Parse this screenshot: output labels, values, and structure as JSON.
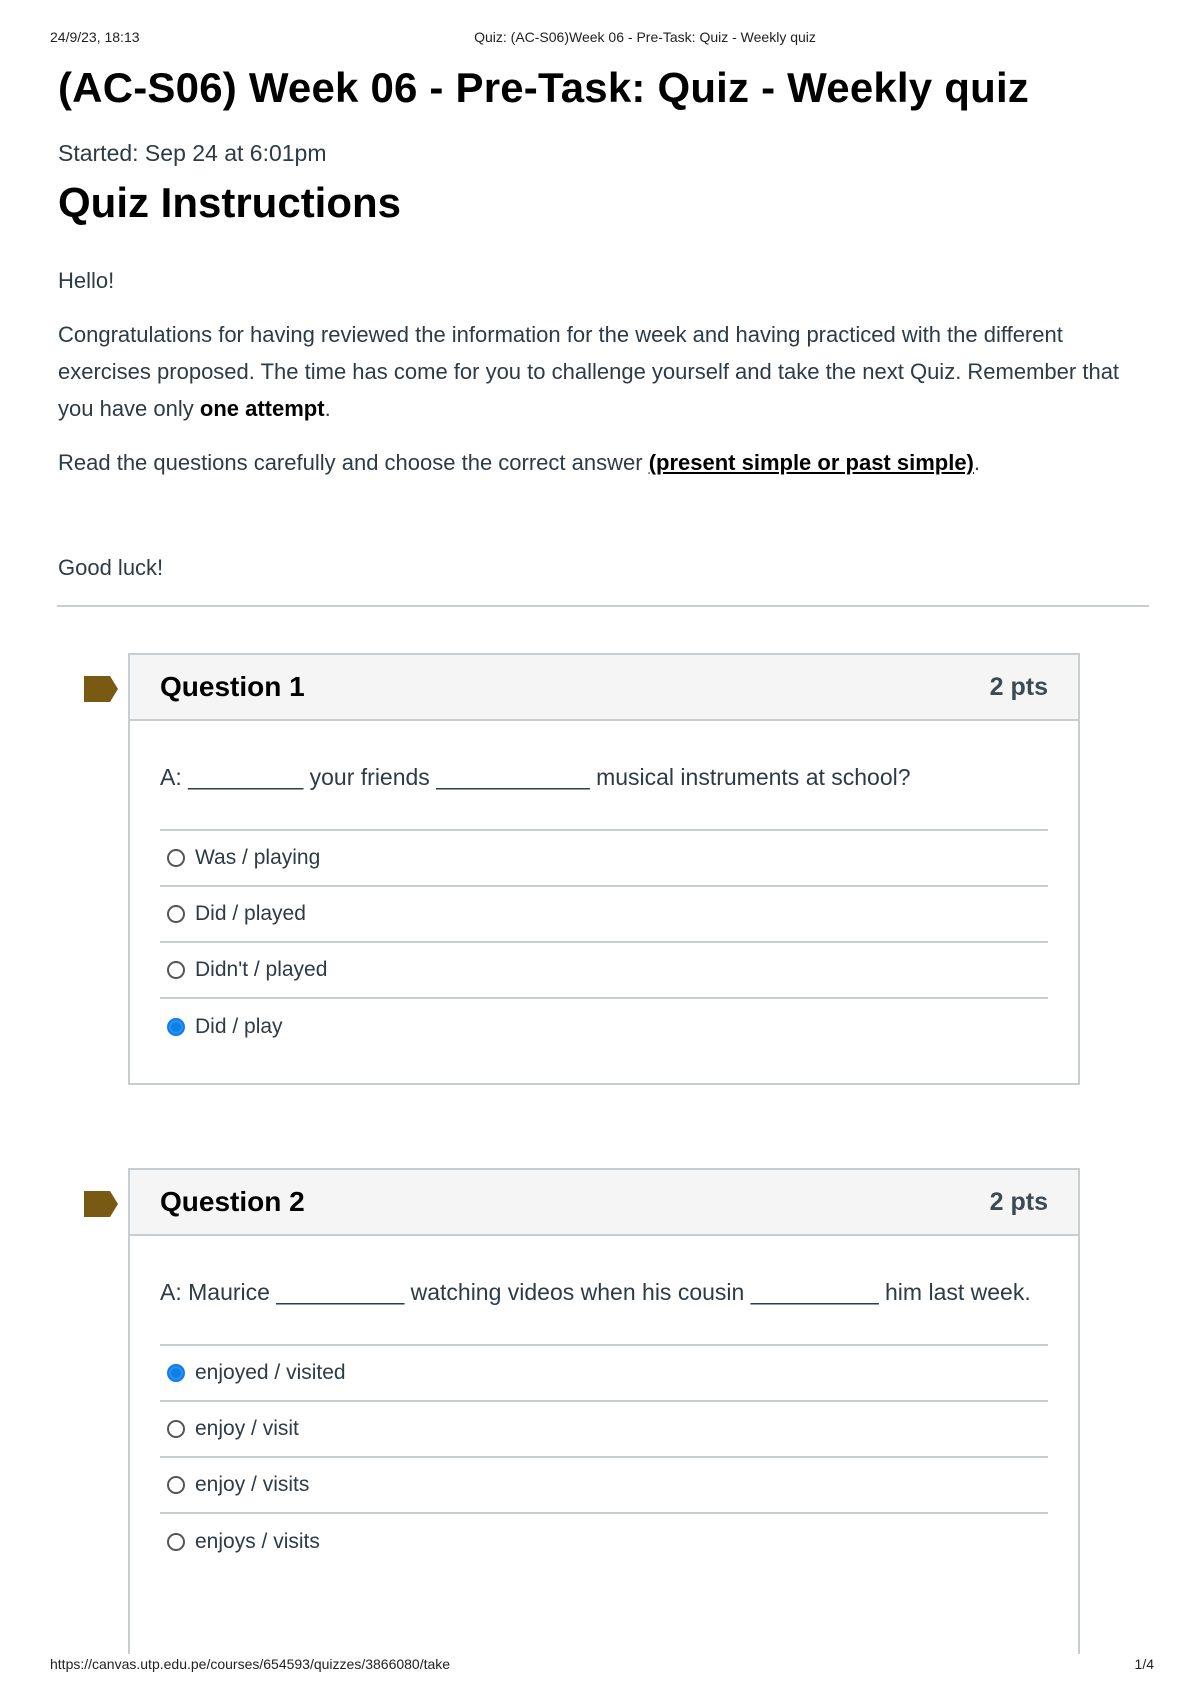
{
  "print_header": {
    "date": "24/9/23, 18:13",
    "title": "Quiz: (AC-S06)Week 06 - Pre-Task: Quiz - Weekly quiz"
  },
  "print_footer": {
    "url": "https://canvas.utp.edu.pe/courses/654593/quizzes/3866080/take",
    "page": "1/4"
  },
  "quiz": {
    "title": "(AC-S06) Week 06 - Pre-Task: Quiz - Weekly quiz",
    "started": "Started: Sep 24 at 6:01pm",
    "instructions_heading": "Quiz Instructions",
    "greeting": "Hello!",
    "paragraph1": "Congratulations for having reviewed the information for the week and having practiced with the different exercises proposed. The time has come for you to challenge yourself and take the next Quiz. Remember that you have only",
    "paragraph1_bold": "one attempt",
    "paragraph1_end": ".",
    "paragraph2": "Read the questions carefully and choose the correct answer",
    "paragraph2_bold": "(present simple or past simple)",
    "paragraph2_end": ".",
    "closing": "Good luck!"
  },
  "questions": [
    {
      "name": "Question 1",
      "points": "2 pts",
      "text": "A: _________  your friends ____________ musical instruments at school?",
      "answers": [
        {
          "label": "Was / playing",
          "selected": false
        },
        {
          "label": "Did / played",
          "selected": false
        },
        {
          "label": "Didn't / played",
          "selected": false
        },
        {
          "label": "Did / play",
          "selected": true
        }
      ]
    },
    {
      "name": "Question 2",
      "points": "2 pts",
      "text": "A: Maurice __________ watching videos when his cousin __________ him last week.",
      "answers": [
        {
          "label": "enjoyed / visited",
          "selected": true
        },
        {
          "label": "enjoy / visit",
          "selected": false
        },
        {
          "label": "enjoy / visits",
          "selected": false
        },
        {
          "label": "enjoys / visits",
          "selected": false
        }
      ]
    }
  ],
  "colors": {
    "flag": "#7a5a12",
    "radio_selected": "#0d7fe8",
    "border": "#c7cdd1",
    "header_bg": "#f5f5f5"
  }
}
